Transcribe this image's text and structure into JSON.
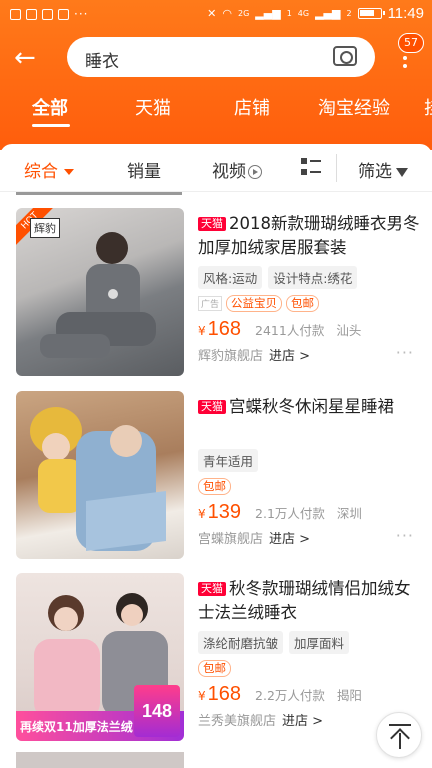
{
  "status_bar": {
    "time": "11:49",
    "signal_a": "2G",
    "signal_b": "4G",
    "sim_a": "1",
    "sim_b": "2",
    "dots": "···"
  },
  "search": {
    "query": "睡衣",
    "message_badge": "57"
  },
  "tabs": [
    {
      "label": "全部",
      "active": true
    },
    {
      "label": "天猫"
    },
    {
      "label": "店铺"
    },
    {
      "label": "淘宝经验"
    },
    {
      "label": "挂"
    }
  ],
  "sort": {
    "comprehensive": "综合",
    "sales": "销量",
    "video": "视频",
    "filter": "筛选"
  },
  "products": [
    {
      "tmall_badge": "天猫",
      "title": "2018新款珊瑚绒睡衣男冬加厚加绒家居服套装",
      "tags": [
        "风格:运动",
        "设计特点:绣花"
      ],
      "ad": "广告",
      "promo": [
        "公益宝贝",
        "包邮"
      ],
      "yen": "¥",
      "price": "168",
      "sold": "2411人付款",
      "location": "汕头",
      "shop": "辉豹旗舰店",
      "enter": "进店 >",
      "image_hot": "HOT",
      "image_logo": "辉豹",
      "image_colors": [
        "#c9c6c4",
        "#6f7276",
        "#3f4246"
      ]
    },
    {
      "tmall_badge": "天猫",
      "title": "宫蝶秋冬休闲星星睡裙",
      "tags": [
        "青年适用"
      ],
      "promo": [
        "包邮"
      ],
      "yen": "¥",
      "price": "139",
      "sold": "2.1万人付款",
      "location": "深圳",
      "shop": "宫蝶旗舰店",
      "enter": "进店 >",
      "image_colors": [
        "#b88a63",
        "#8fb0d0",
        "#e8c44a"
      ]
    },
    {
      "tmall_badge": "天猫",
      "title": "秋冬款珊瑚绒情侣加绒女士法兰绒睡衣",
      "tags": [
        "涤纶耐磨抗皱",
        "加厚面料"
      ],
      "promo": [
        "包邮"
      ],
      "yen": "¥",
      "price": "168",
      "sold": "2.2万人付款",
      "location": "揭阳",
      "shop": "兰秀美旗舰店",
      "enter": "进店 >",
      "banner_text": "再续双11加厚法兰绒",
      "banner_price": "148",
      "image_colors": [
        "#e9d7d3",
        "#f2b8c4",
        "#8e8e96"
      ]
    }
  ],
  "colors": {
    "accent": "#ff5000",
    "tmall": "#ff0036",
    "header": "#ff6a12"
  }
}
